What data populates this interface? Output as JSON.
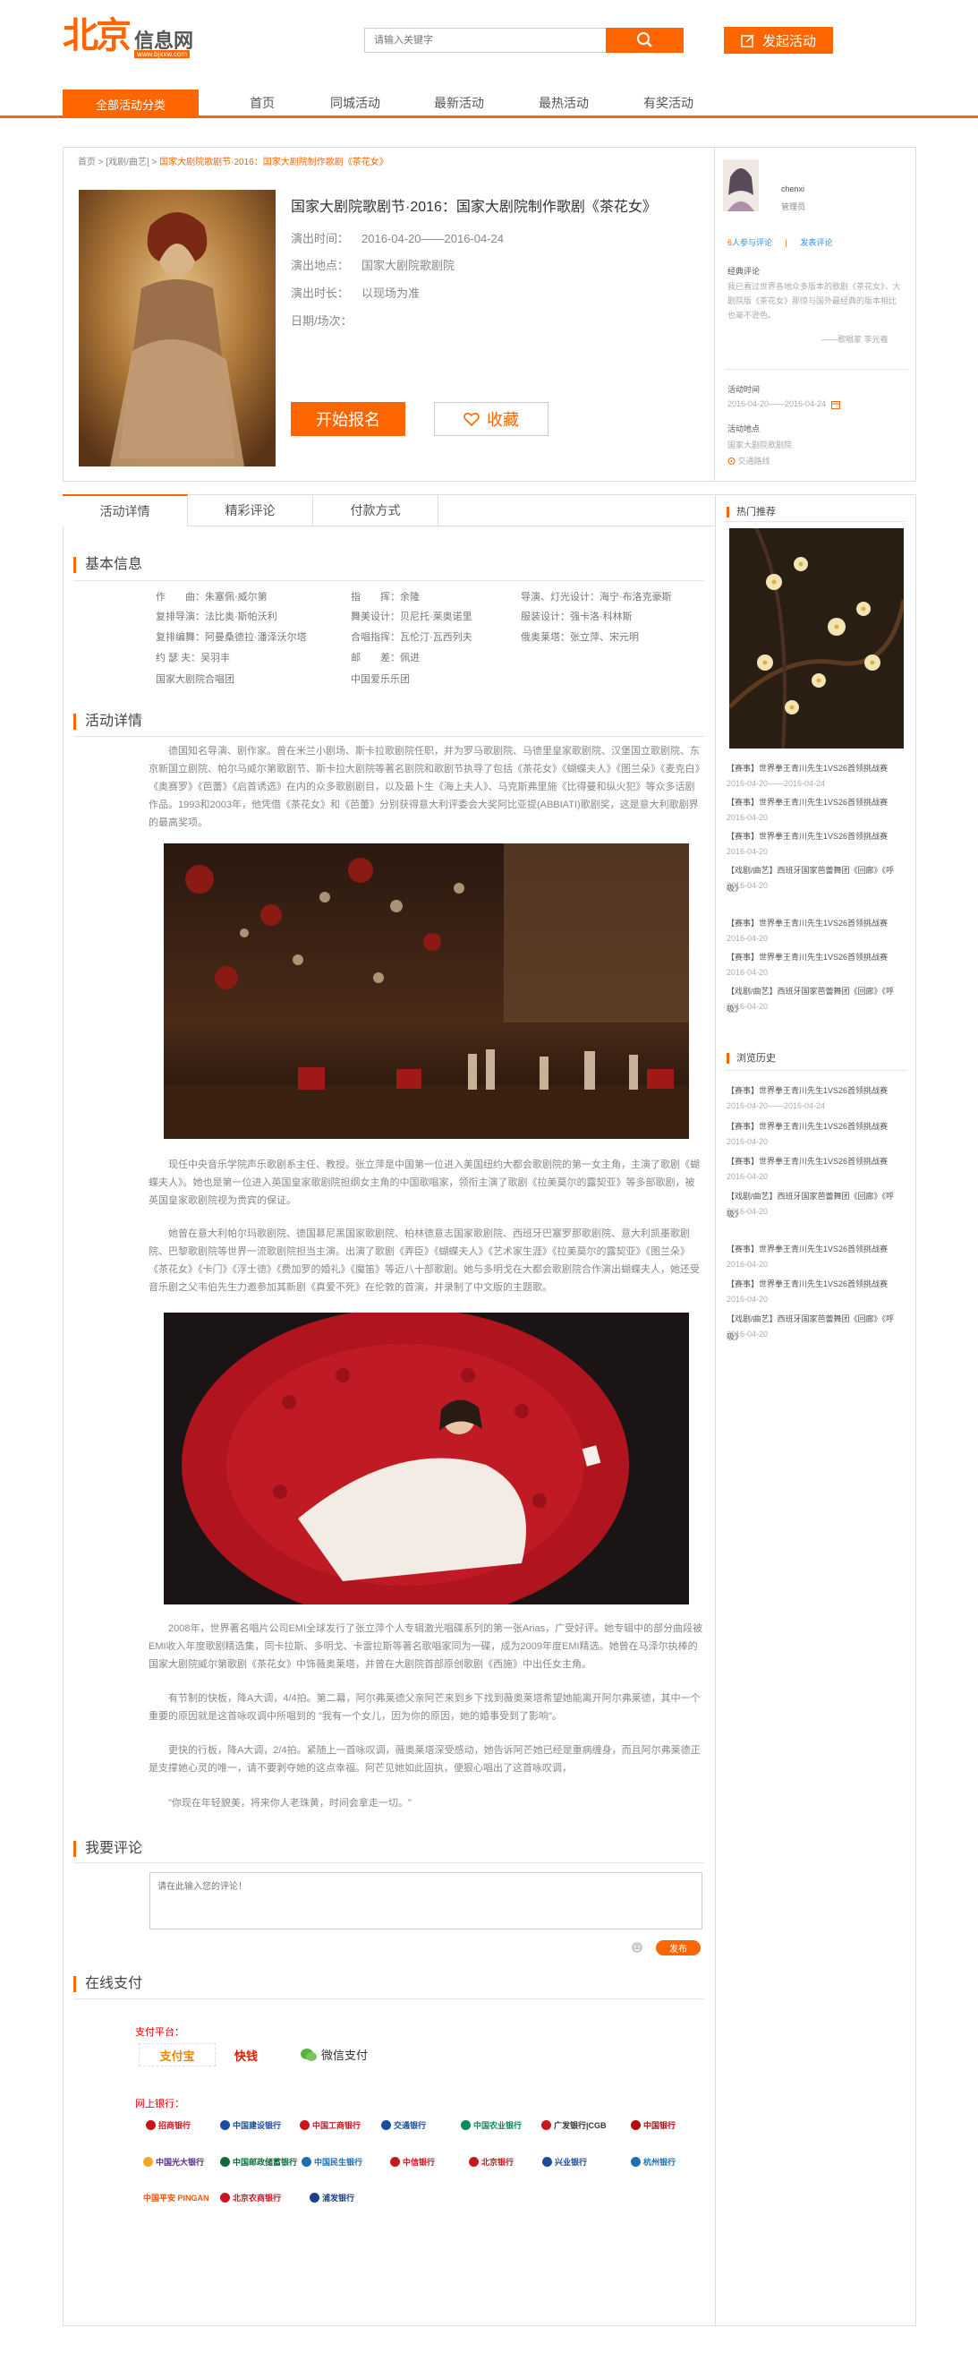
{
  "header": {
    "logo_big": "北京",
    "logo_small": "信息网",
    "logo_url": "www.bjxxw.com",
    "search_placeholder": "请输入关键字",
    "publish_label": "发起活动"
  },
  "nav": {
    "category_label": "全部活动分类",
    "items": [
      "首页",
      "同城活动",
      "最新活动",
      "最热活动",
      "有奖活动"
    ]
  },
  "breadcrumb": {
    "home": "首页",
    "sep": " > ",
    "section": "[戏剧/曲艺]",
    "current": "国家大剧院歌剧节·2016：国家大剧院制作歌剧《茶花女》"
  },
  "event": {
    "title": "国家大剧院歌剧节·2016：国家大剧院制作歌剧《茶花女》",
    "meta": [
      {
        "label": "演出时间：",
        "value": "2016-04-20——2016-04-24"
      },
      {
        "label": "演出地点：",
        "value": "国家大剧院歌剧院"
      },
      {
        "label": "演出时长：",
        "value": "以现场为准"
      },
      {
        "label": "日期/场次：",
        "value": ""
      }
    ],
    "signup_label": "开始报名",
    "favorite_label": "收藏"
  },
  "organizer": {
    "name": "chenxi",
    "role": "管理员",
    "joined_count": "6",
    "joined_label": "人参与评论",
    "divider": "|",
    "comment_label": "发表评论",
    "quote_title": "经典评论",
    "quote_text": "我已看过世界各地众多版本的歌剧《茶花女》，大剧院版《茶花女》那惊与国外最经典的版本相比也毫不逊色。",
    "quote_author": "——歌唱家 李光羲",
    "time_title": "活动时间",
    "time_value": "2016-04-20——2016-04-24",
    "place_title": "活动地点",
    "place_value": "国家大剧院歌剧院",
    "route_label": "交通路线"
  },
  "tabs": [
    "活动详情",
    "精彩评论",
    "付款方式"
  ],
  "basic_info": {
    "title": "基本信息",
    "rows": [
      [
        "作　　曲：朱塞佩·威尔第",
        "指　　挥：余隆",
        "导演、灯光设计：海宁·布洛克豪斯"
      ],
      [
        "复排导演：法比奥·斯帕沃利",
        "舞美设计：贝尼托·莱奥诺里",
        "服装设计：强卡洛·科林斯"
      ],
      [
        "复排编舞：阿曼桑德拉·潘泽沃尔塔",
        "合唱指挥：瓦伦汀·瓦西列夫",
        "俄奥莱塔：张立萍、宋元明"
      ],
      [
        "约 瑟 夫：吴羽丰",
        "邮　　差：佩进",
        ""
      ],
      [
        "国家大剧院合唱团",
        "中国爱乐乐团",
        ""
      ]
    ]
  },
  "detail": {
    "title": "活动详情",
    "paragraphs": [
      "德国知名导演、剧作家。曾在米兰小剧场、斯卡拉歌剧院任职，并为罗马歌剧院、马德里皇家歌剧院、汉堡国立歌剧院、东京新国立剧院、帕尔马威尔第歌剧节、斯卡拉大剧院等著名剧院和歌剧节执导了包括《茶花女》《蝴蝶夫人》《图兰朵》《麦克白》《奥赛罗》《芭蕾》《启首诱选》在内的众多歌剧剧目，以及最卜生《海上夫人》、马克斯弗里施《比得曼和纵火犯》等众多话剧作品。1993和2003年，他凭借《茶花女》和《芭蕾》分别获得意大利评委会大奖阿比亚提(ABBIATI)歌剧奖，这是意大利歌剧界的最高奖项。",
      "现任中央音乐学院声乐歌剧系主任、教授。张立萍是中国第一位进入美国纽约大都会歌剧院的第一女主角，主演了歌剧《蝴蝶夫人》。她也是第一位进入英国皇家歌剧院担纲女主角的中国歌唱家，领衔主演了歌剧《拉美莫尔的露契亚》等多部歌剧，被英国皇家歌剧院视为贵宾的保证。",
      "她曾在意大利帕尔玛歌剧院、德国慕尼黑国家歌剧院、柏林德意志国家歌剧院、西班牙巴塞罗那歌剧院、意大利凯墨歌剧院、巴黎歌剧院等世界一流歌剧院担当主演。出演了歌剧《弄臣》《蝴蝶夫人》《艺术家生涯》《拉美莫尔的露契亚》《图兰朵》《茶花女》《卡门》《浮士德》《费加罗的婚礼》《魔笛》等近八十部歌剧。她与多明戈在大都会歌剧院合作演出蝴蝶夫人，她还受音乐剧之父韦伯先生力邀参加其新剧《真爱不死》在伦敦的首演，并录制了中文版的主题歌。",
      "2008年，世界著名唱片公司EMI全球发行了张立萍个人专辑激光唱碟系列的第一张Arias，广受好评。她专辑中的部分曲段被EMI收入年度歌剧精选集，同卡拉斯、多明戈、卡雷拉斯等著名歌唱家同为一碟，成为2009年度EMI精选。她曾在马泽尔执棒的国家大剧院威尔第歌剧《茶花女》中饰薇奥莱塔，并曾在大剧院首部原创歌剧《西施》中出任女主角。",
      "有节制的快板，降A大调，4/4拍。第二幕，阿尔弗莱德父亲阿芒来到乡下找到薇奥莱塔希望她能离开阿尔弗莱德，其中一个重要的原因就是这首咏叹调中所唱到的 \"我有一个女儿，因为你的原因，她的婚事受到了影响\"。",
      "更快的行板，降A大调，2/4拍。紧随上一首咏叹调，薇奥莱塔深受感动，她告诉阿芒她已经是重病缠身，而且阿尔弗莱德正是支撑她心灵的唯一，请不要剥夺她的这点幸福。阿芒见她如此固执，便狠心唱出了这首咏叹调，",
      "\"你现在年轻貌美，将来你人老珠黄，时间会拿走一切。\""
    ]
  },
  "comment": {
    "title": "我要评论",
    "placeholder": "请在此输入您的评论！",
    "submit_label": "发布"
  },
  "payment": {
    "title": "在线支付",
    "platform_label": "支付平台：",
    "platforms": [
      "支付宝",
      "快钱",
      "微信支付"
    ],
    "bank_label": "网上银行：",
    "banks": [
      [
        "招商银行",
        "中国建设银行",
        "中国工商银行",
        "交通银行",
        "中国农业银行",
        "广发银行|CGB",
        "中国银行"
      ],
      [
        "中国光大银行",
        "中国邮政储蓄银行",
        "中国民生银行",
        "中信银行",
        "北京银行",
        "兴业银行",
        "杭州银行"
      ],
      [
        "中国平安 PINGAN",
        "北京农商银行",
        "浦发银行"
      ]
    ]
  },
  "sidebar": {
    "hot_title": "热门推荐",
    "hot_items": [
      {
        "title": "【赛事】世界拳王青川先生1VS26首领挑战赛",
        "date": "2016-04-20——2016-04-24"
      },
      {
        "title": "【赛事】世界拳王青川先生1VS26首领挑战赛",
        "date": "2016-04-20"
      },
      {
        "title": "【赛事】世界拳王青川先生1VS26首领挑战赛",
        "date": "2016-04-20"
      },
      {
        "title": "【戏剧/曲艺】西班牙国家芭蕾舞团《回廊》《呼吸》",
        "date": "2016-04-20"
      },
      {
        "title": "【赛事】世界拳王青川先生1VS26首领挑战赛",
        "date": "2016-04-20"
      },
      {
        "title": "【赛事】世界拳王青川先生1VS26首领挑战赛",
        "date": "2016-04-20"
      },
      {
        "title": "【戏剧/曲艺】西班牙国家芭蕾舞团《回廊》《呼吸》",
        "date": "2016-04-20"
      }
    ],
    "history_title": "浏览历史",
    "history_items": [
      {
        "title": "【赛事】世界拳王青川先生1VS26首领挑战赛",
        "date": "2016-04-20——2016-04-24"
      },
      {
        "title": "【赛事】世界拳王青川先生1VS26首领挑战赛",
        "date": "2016-04-20"
      },
      {
        "title": "【赛事】世界拳王青川先生1VS26首领挑战赛",
        "date": "2016-04-20"
      },
      {
        "title": "【戏剧/曲艺】西班牙国家芭蕾舞团《回廊》《呼吸》",
        "date": "2016-04-20"
      },
      {
        "title": "【赛事】世界拳王青川先生1VS26首领挑战赛",
        "date": "2016-04-20"
      },
      {
        "title": "【赛事】世界拳王青川先生1VS26首领挑战赛",
        "date": "2016-04-20"
      },
      {
        "title": "【戏剧/曲艺】西班牙国家芭蕾舞团《回廊》《呼吸》",
        "date": "2016-04-20"
      }
    ]
  },
  "colors": {
    "accent": "#ff6600",
    "border": "#dddddd",
    "text": "#555555"
  }
}
